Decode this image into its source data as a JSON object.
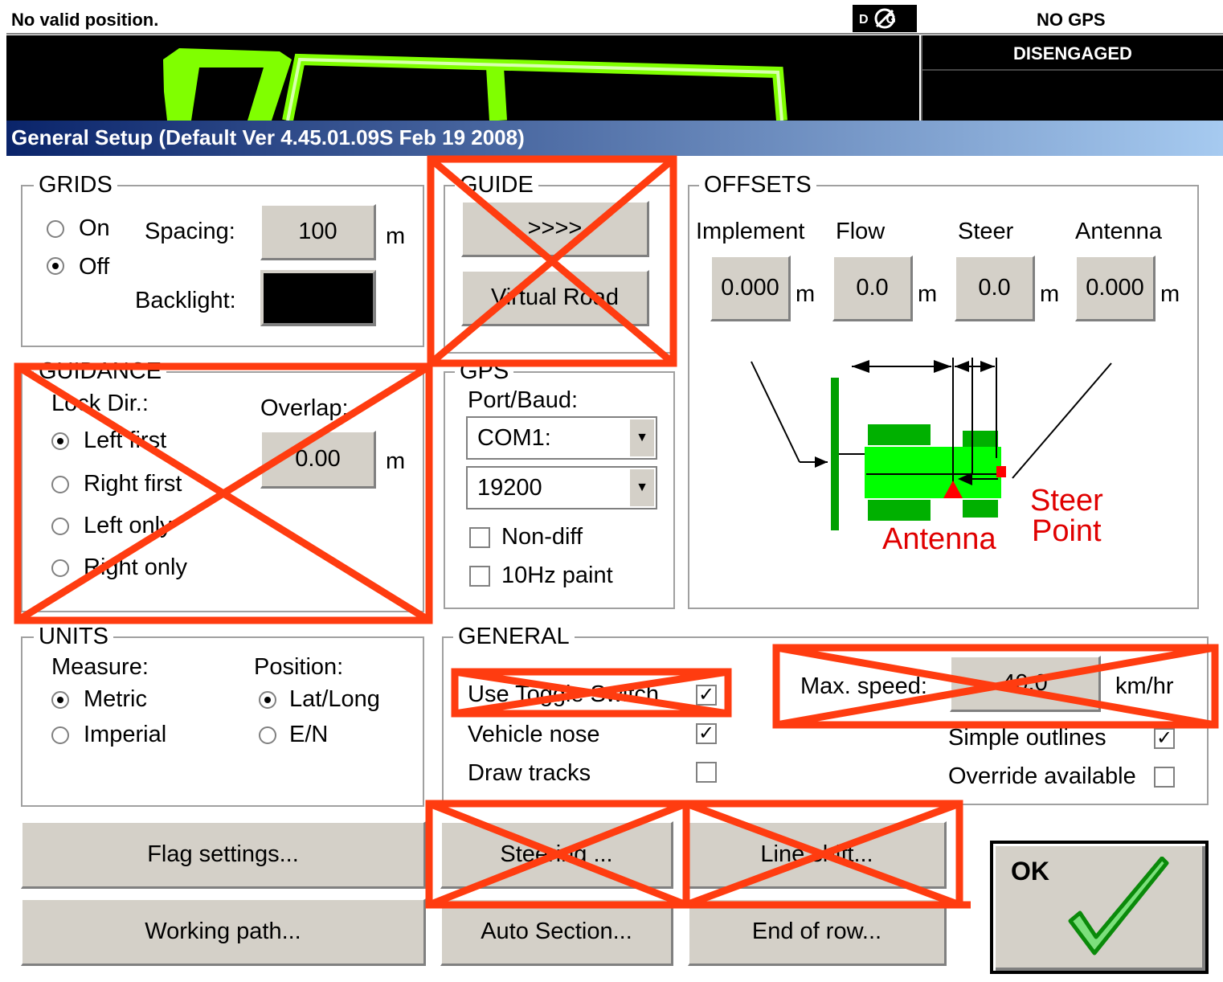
{
  "status": {
    "position_text": "No valid position.",
    "dgps_badge": "DG",
    "gps_status": "NO GPS",
    "engage_status": "DISENGAGED"
  },
  "window": {
    "title": "General Setup (Default Ver 4.45.01.09S Feb 19 2008)"
  },
  "grids": {
    "legend": "GRIDS",
    "on_label": "On",
    "off_label": "Off",
    "spacing_label": "Spacing:",
    "spacing_value": "100",
    "spacing_unit": "m",
    "backlight_label": "Backlight:"
  },
  "guide": {
    "legend": "GUIDE",
    "arrows_button": ">>>>",
    "virtual_road_button": "Virtual Road"
  },
  "offsets": {
    "legend": "OFFSETS",
    "columns": [
      {
        "label": "Implement",
        "value": "0.000",
        "unit": "m"
      },
      {
        "label": "Flow",
        "value": "0.0",
        "unit": "m"
      },
      {
        "label": "Steer",
        "value": "0.0",
        "unit": "m"
      },
      {
        "label": "Antenna",
        "value": "0.000",
        "unit": "m"
      }
    ],
    "diagram_antenna_label": "Antenna",
    "diagram_steer_label_1": "Steer",
    "diagram_steer_label_2": "Point"
  },
  "guidance": {
    "legend": "GUIDANCE",
    "lock_dir_label": "Lock Dir.:",
    "options": [
      "Left first",
      "Right first",
      "Left only",
      "Right only"
    ],
    "selected": "Left first",
    "overlap_label": "Overlap:",
    "overlap_value": "0.00",
    "overlap_unit": "m"
  },
  "gps": {
    "legend": "GPS",
    "port_label": "Port/Baud:",
    "port_value": "COM1:",
    "baud_value": "19200",
    "non_diff_label": "Non-diff",
    "paint_label": "10Hz paint"
  },
  "units": {
    "legend": "UNITS",
    "measure_label": "Measure:",
    "metric_label": "Metric",
    "imperial_label": "Imperial",
    "position_label": "Position:",
    "latlong_label": "Lat/Long",
    "en_label": "E/N"
  },
  "general": {
    "legend": "GENERAL",
    "toggle_switch_label": "Use Toggle Switch",
    "vehicle_nose_label": "Vehicle nose",
    "draw_tracks_label": "Draw tracks",
    "max_speed_label": "Max. speed:",
    "max_speed_value": "40.0",
    "max_speed_unit": "km/hr",
    "simple_outlines_label": "Simple outlines",
    "override_label": "Override available"
  },
  "buttons": {
    "flag_settings": "Flag settings...",
    "working_path": "Working path...",
    "steering": "Steering ...",
    "auto_section": "Auto Section...",
    "line_shift": "Line shift...",
    "end_of_row": "End of row...",
    "ok": "OK"
  },
  "colors": {
    "annotation_red": "#ff3c10",
    "path_green": "#80ff00",
    "title_gradient_start": "#0a246a",
    "title_gradient_end": "#a6caf0",
    "button_face": "#d4d0c8"
  }
}
